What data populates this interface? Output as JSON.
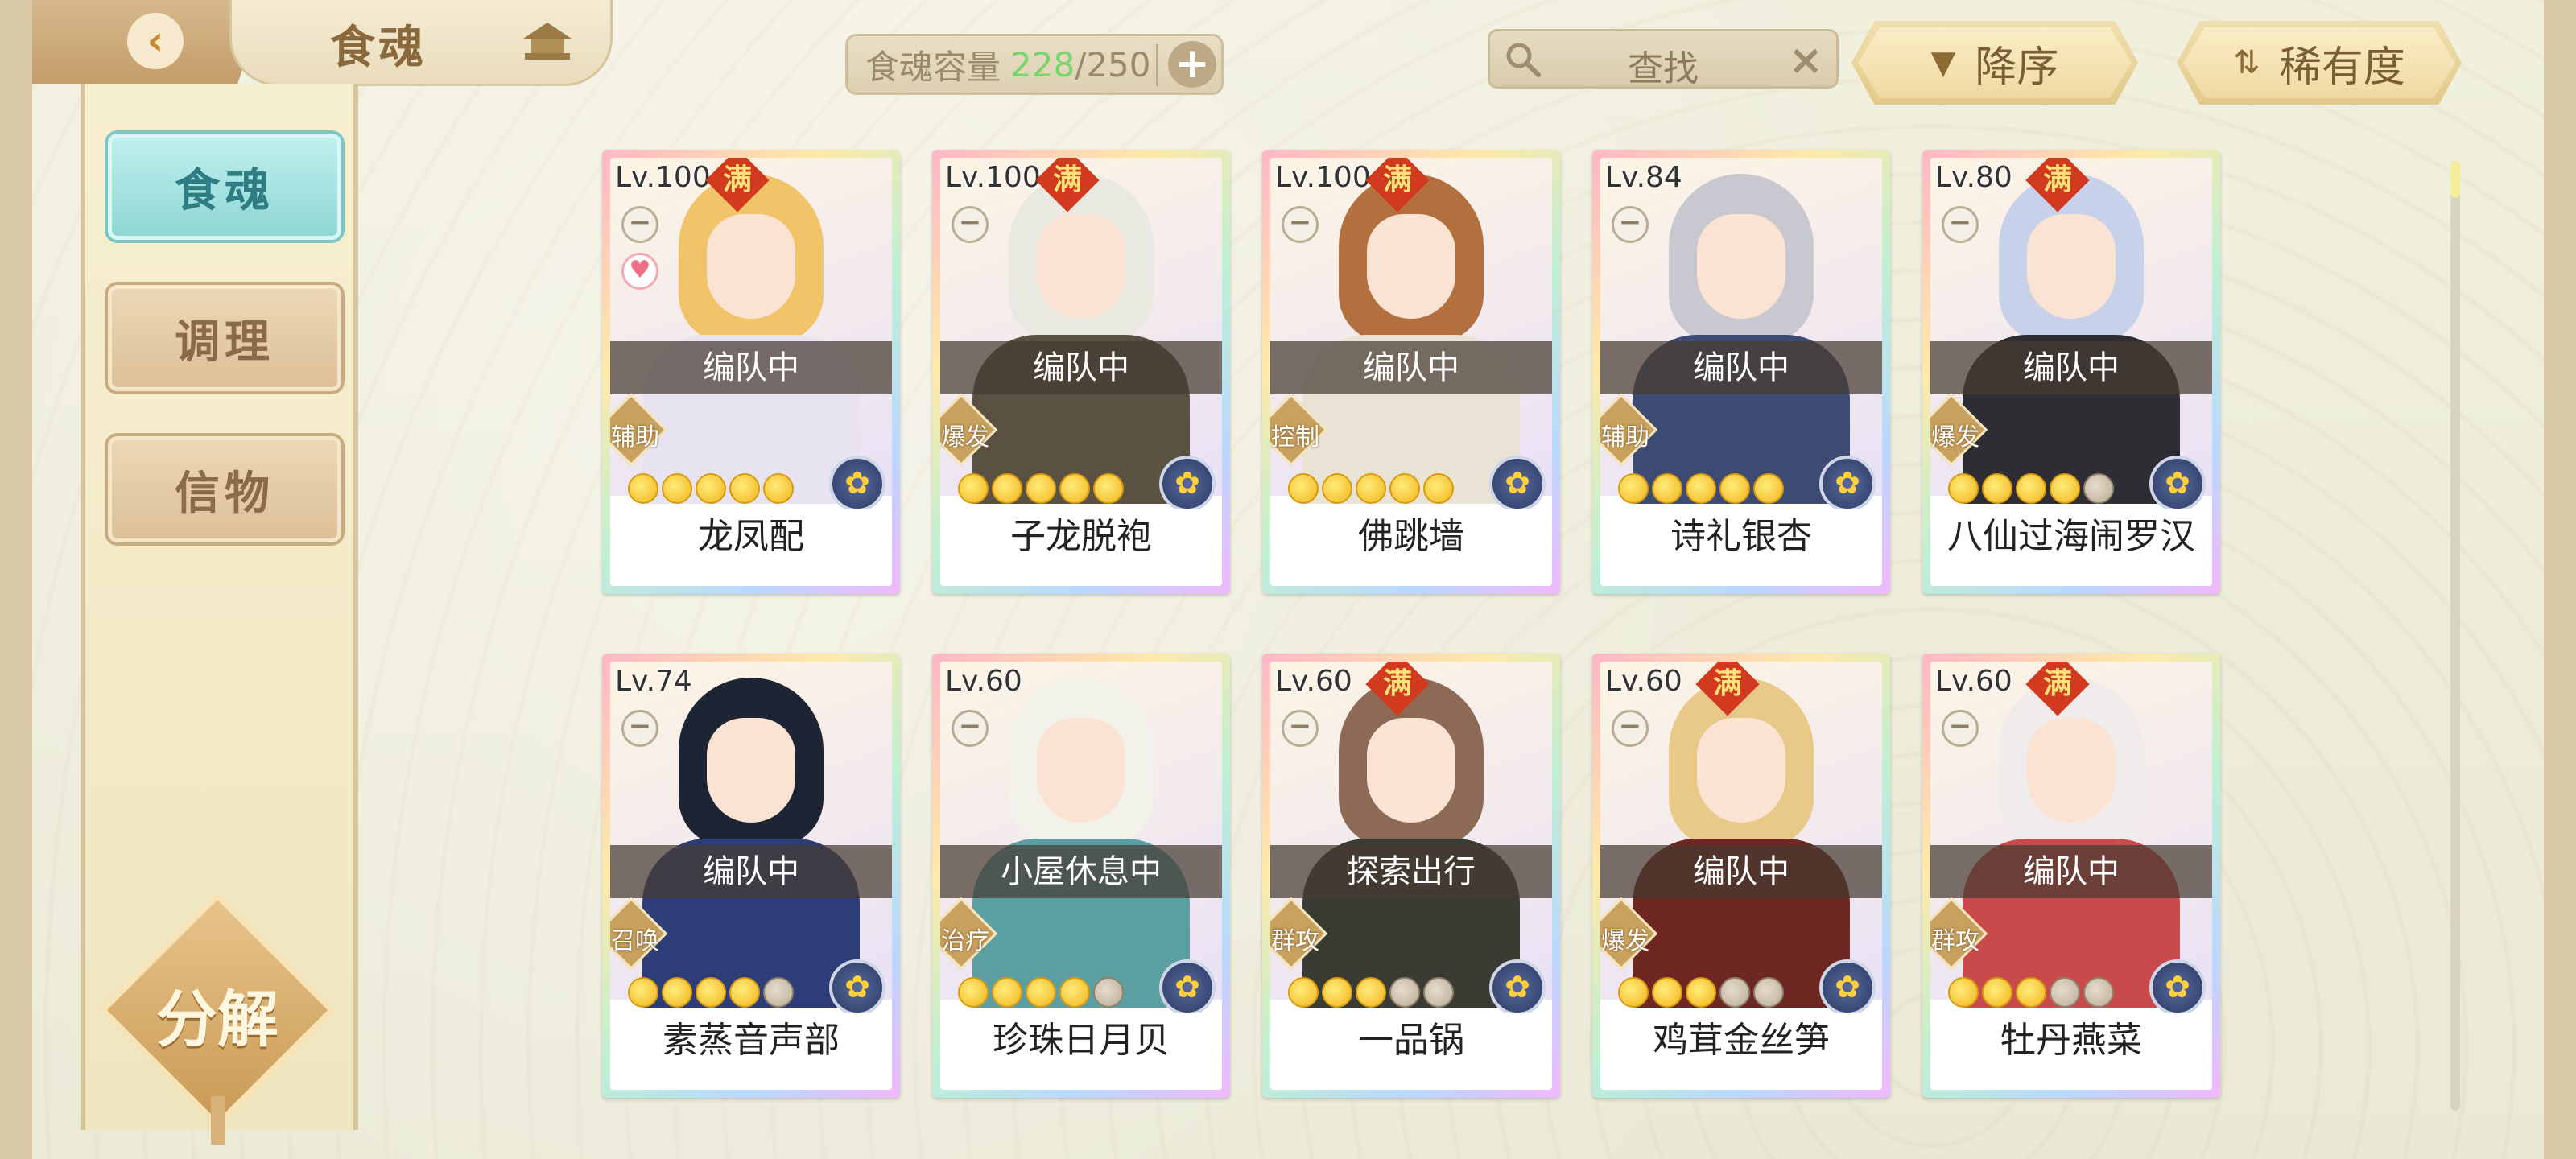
{
  "header": {
    "title": "食魂",
    "capacity_label": "食魂容量",
    "capacity_used": "228",
    "capacity_total": "/250",
    "capacity_add": "+",
    "search_placeholder": "查找",
    "search_clear": "×",
    "sort_label": "降序",
    "filter_label": "稀有度"
  },
  "sidebar": {
    "items": [
      {
        "label": "食魂",
        "active": true
      },
      {
        "label": "调理",
        "active": false
      },
      {
        "label": "信物",
        "active": false
      }
    ],
    "decompose_label": "分解"
  },
  "cards": [
    {
      "level": "Lv.100",
      "full": "满",
      "status": "编队中",
      "role": "辅助",
      "name": "龙凤配",
      "stars": 5,
      "max_stars": 5,
      "heart": true,
      "hair": "#f1c46a",
      "body": "#e7e3f1"
    },
    {
      "level": "Lv.100",
      "full": "满",
      "status": "编队中",
      "role": "爆发",
      "name": "子龙脱袍",
      "stars": 5,
      "max_stars": 5,
      "heart": false,
      "hair": "#e9e8e1",
      "body": "#5a5142"
    },
    {
      "level": "Lv.100",
      "full": "满",
      "status": "编队中",
      "role": "控制",
      "name": "佛跳墙",
      "stars": 5,
      "max_stars": 5,
      "heart": false,
      "hair": "#b3703f",
      "body": "#e8e3d4"
    },
    {
      "level": "Lv.84",
      "full": "",
      "status": "编队中",
      "role": "辅助",
      "name": "诗礼银杏",
      "stars": 5,
      "max_stars": 5,
      "heart": false,
      "hair": "#c9c7d0",
      "body": "#3d4b72"
    },
    {
      "level": "Lv.80",
      "full": "满",
      "status": "编队中",
      "role": "爆发",
      "name": "八仙过海闹罗汉",
      "stars": 4,
      "max_stars": 5,
      "heart": false,
      "hair": "#c8d1ea",
      "body": "#2d2d33"
    },
    {
      "level": "Lv.74",
      "full": "",
      "status": "编队中",
      "role": "召唤",
      "name": "素蒸音声部",
      "stars": 4,
      "max_stars": 5,
      "heart": false,
      "hair": "#1d2433",
      "body": "#2c3d78"
    },
    {
      "level": "Lv.60",
      "full": "",
      "status": "小屋休息中",
      "role": "治疗",
      "name": "珍珠日月贝",
      "stars": 4,
      "max_stars": 5,
      "heart": false,
      "hair": "#f2f1ea",
      "body": "#5c9fa3"
    },
    {
      "level": "Lv.60",
      "full": "满",
      "status": "探索出行",
      "role": "群攻",
      "name": "一品锅",
      "stars": 3,
      "max_stars": 5,
      "heart": false,
      "hair": "#8d6a55",
      "body": "#3a3b33"
    },
    {
      "level": "Lv.60",
      "full": "满",
      "status": "编队中",
      "role": "爆发",
      "name": "鸡茸金丝笋",
      "stars": 3,
      "max_stars": 5,
      "heart": false,
      "hair": "#e9c987",
      "body": "#6e2722"
    },
    {
      "level": "Lv.60",
      "full": "满",
      "status": "编队中",
      "role": "群攻",
      "name": "牡丹燕菜",
      "stars": 3,
      "max_stars": 5,
      "heart": false,
      "hair": "#f0eceb",
      "body": "#c94a4a"
    }
  ],
  "icons": {
    "back": "chevron-left-icon",
    "home": "pagoda-icon",
    "search": "magnifier-icon",
    "sort": "triangle-down-icon",
    "filter": "sort-arrows-icon",
    "emblem": "flower-icon"
  },
  "colors": {
    "accent_teal": "#8fd6d4",
    "gold": "#f3b41b",
    "full_badge": "#d23a1f",
    "capacity_used": "#7bd36d"
  }
}
